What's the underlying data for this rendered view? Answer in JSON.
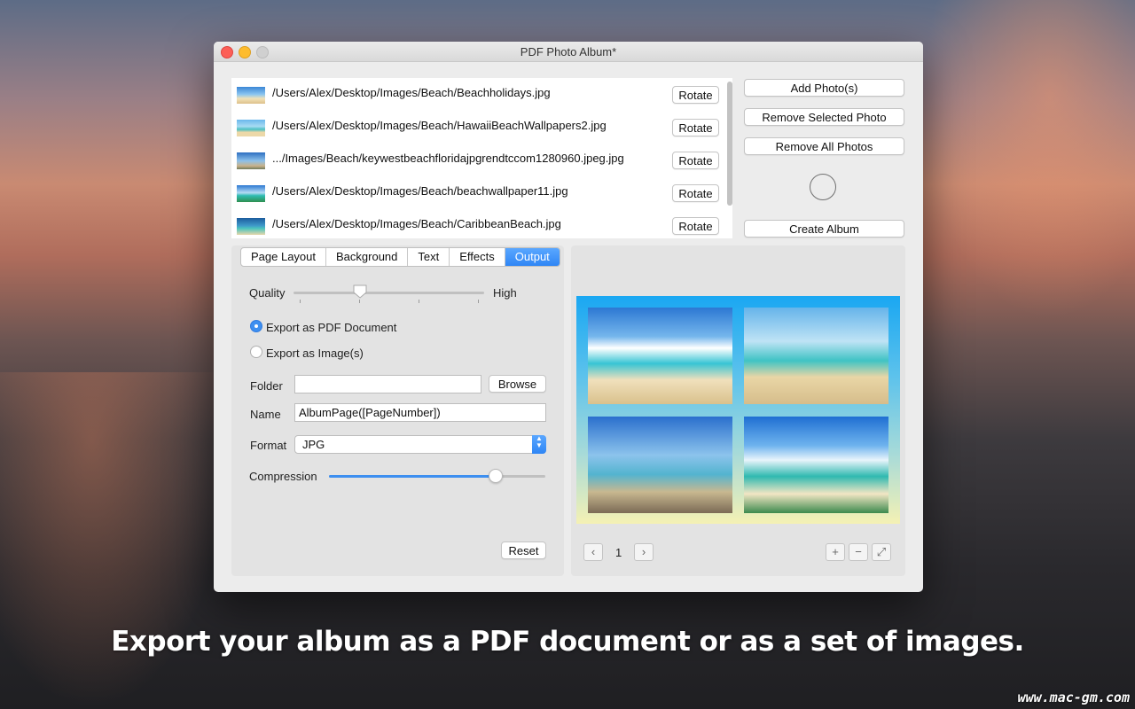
{
  "window": {
    "title": "PDF Photo Album*"
  },
  "files": [
    {
      "path": "/Users/Alex/Desktop/Images/Beach/Beachholidays.jpg",
      "rotate_label": "Rotate",
      "thumb": "t1"
    },
    {
      "path": "/Users/Alex/Desktop/Images/Beach/HawaiiBeachWallpapers2.jpg",
      "rotate_label": "Rotate",
      "thumb": "t2"
    },
    {
      "path": ".../Images/Beach/keywestbeachfloridajpgrendtccom1280960.jpeg.jpg",
      "rotate_label": "Rotate",
      "thumb": "t3"
    },
    {
      "path": "/Users/Alex/Desktop/Images/Beach/beachwallpaper11.jpg",
      "rotate_label": "Rotate",
      "thumb": "t4"
    },
    {
      "path": "/Users/Alex/Desktop/Images/Beach/CaribbeanBeach.jpg",
      "rotate_label": "Rotate",
      "thumb": "t5"
    }
  ],
  "actions": {
    "add": "Add Photo(s)",
    "remove_selected": "Remove Selected Photo",
    "remove_all": "Remove All Photos",
    "create": "Create Album"
  },
  "tabs": [
    "Page Layout",
    "Background",
    "Text",
    "Effects",
    "Output"
  ],
  "output": {
    "quality_label": "Quality",
    "quality_high_label": "High",
    "quality_level": 0.35,
    "export_pdf_label": "Export as PDF Document",
    "export_images_label": "Export as Image(s)",
    "export_selected": "pdf",
    "folder_label": "Folder",
    "folder_value": "",
    "browse_label": "Browse",
    "name_label": "Name",
    "name_value": "AlbumPage([PageNumber])",
    "format_label": "Format",
    "format_value": "JPG",
    "compression_label": "Compression",
    "compression_level": 0.77,
    "reset_label": "Reset"
  },
  "preview": {
    "page_number": "1",
    "prev_icon": "chevron-left-icon",
    "next_icon": "chevron-right-icon",
    "zoom_in_icon": "plus-icon",
    "zoom_out_icon": "minus-icon",
    "fit_icon": "expand-icon"
  },
  "caption": "Export your album as a PDF document or as a set of images.",
  "watermark": "www.mac-gm.com",
  "colors": {
    "accent": "#3d8ff0",
    "close": "#fc5f57",
    "minimize": "#fdbc2e"
  }
}
